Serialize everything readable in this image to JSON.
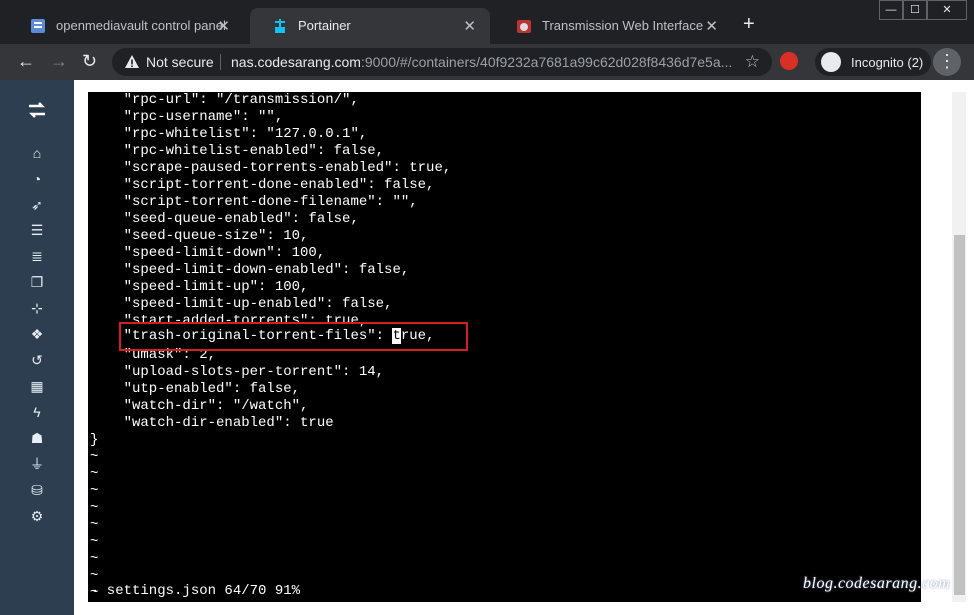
{
  "browser": {
    "tabs": [
      {
        "title": "openmediavault control panel - ",
        "active": false
      },
      {
        "title": "Portainer",
        "active": true
      },
      {
        "title": "Transmission Web Interface",
        "active": false
      }
    ],
    "new_tab_symbol": "+",
    "window_controls": [
      "—",
      "☐",
      "✕"
    ],
    "tab_close_symbol": "✕"
  },
  "toolbar": {
    "security_label": "Not secure",
    "url_host": "nas.codesarang.com",
    "url_rest": ":9000/#/containers/40f9232a7681a99c62d028f8436d7e5a...",
    "incognito_label": "Incognito (2)",
    "back_symbol": "←",
    "forward_symbol": "→",
    "reload_symbol": "↻",
    "star_symbol": "☆",
    "menu_symbol": "⋮"
  },
  "sidebar": {
    "icons": [
      "transfer-icon",
      "home-icon",
      "dashboard-icon",
      "rocket-icon",
      "list-icon",
      "server-icon",
      "clone-icon",
      "sitemap-icon",
      "cubes-icon",
      "history-icon",
      "th-icon",
      "bolt-icon",
      "users-icon",
      "plug-icon",
      "database-icon",
      "cogs-icon"
    ]
  },
  "terminal": {
    "lines": [
      "    \"rpc-url\": \"/transmission/\",",
      "    \"rpc-username\": \"\",",
      "    \"rpc-whitelist\": \"127.0.0.1\",",
      "    \"rpc-whitelist-enabled\": false,",
      "    \"scrape-paused-torrents-enabled\": true,",
      "    \"script-torrent-done-enabled\": false,",
      "    \"script-torrent-done-filename\": \"\",",
      "    \"seed-queue-enabled\": false,",
      "    \"seed-queue-size\": 10,",
      "    \"speed-limit-down\": 100,",
      "    \"speed-limit-down-enabled\": false,",
      "    \"speed-limit-up\": 100,",
      "    \"speed-limit-up-enabled\": false,",
      "    \"start-added-torrents\": true,",
      "",
      "    \"umask\": 2,",
      "    \"upload-slots-per-torrent\": 14,",
      "    \"utp-enabled\": false,",
      "    \"watch-dir\": \"/watch\",",
      "    \"watch-dir-enabled\": true",
      "}",
      "~",
      "~",
      "~",
      "~",
      "~",
      "~",
      "~",
      "~",
      "~"
    ],
    "highlighted_prefix": "\"trash-original-torrent-files\": ",
    "highlighted_cursor": "t",
    "highlighted_suffix": "rue,",
    "status_line": "- settings.json 64/70 91%"
  },
  "watermark": "blog.codesarang.com",
  "colors": {
    "sidebar": "#2d3e50",
    "highlight": "#d21f1f",
    "tabstrip": "#202124"
  }
}
